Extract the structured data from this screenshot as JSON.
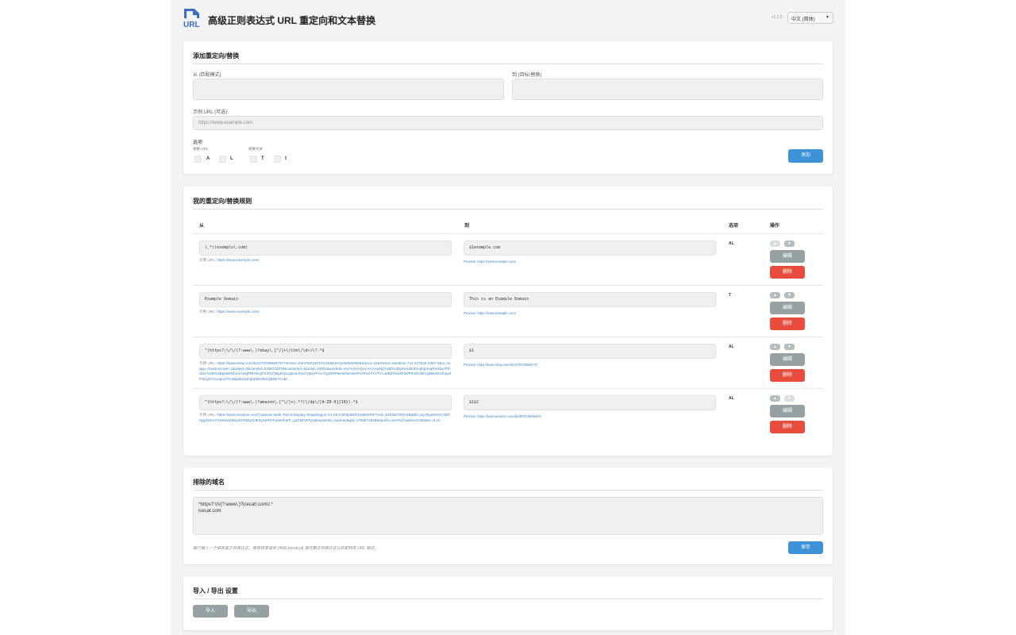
{
  "app": {
    "title": "高级正则表达式 URL 重定向和文本替换",
    "logo_text": "URL",
    "version": "v1.2.0",
    "language": "中文 (简体)"
  },
  "add_section": {
    "title": "添加重定向/替换",
    "from_label": "从 (匹配模式)",
    "to_label": "到 (目标/替换)",
    "example_label": "示例 URL (可选)",
    "example_placeholder": "https://www.example.com",
    "options_label": "选项",
    "replace_url_label": "替换 URL",
    "replace_text_label": "替换文本",
    "checkbox_a": "A",
    "checkbox_l": "L",
    "checkbox_T": "T",
    "checkbox_t": "t",
    "add_button": "添加"
  },
  "rules_section": {
    "title": "我的重定向/替换规则",
    "col_from": "从",
    "col_to": "到",
    "col_options": "选项",
    "col_actions": "操作",
    "example_prefix": "示例 URL:",
    "edit_label": "编辑",
    "delete_label": "删除",
    "up_icon": "▲",
    "down_icon": "▼",
    "rules": [
      {
        "from": "(.*)(exemplo\\.com)",
        "example": "https://www.exemplo.com/",
        "to": "$1example.com",
        "preview": "Preview: https://www.example.com/",
        "options": "AL"
      },
      {
        "from": "Example Domain",
        "example": "https://www.example.com/",
        "to": "This is an Example Domain",
        "preview": "Preview: https://www.example.com/",
        "options": "T"
      },
      {
        "from": "^(https?:\\/\\/(?:www\\.)?ebay\\.[^/]+\\/itm\\/\\d+)\\?.*$",
        "example": "https://www.ebay.com/itm/276709550737?mmsrc=01KFDZ1SFZ4V2X9HZAQA83MG9M&mkcid=16&mkevt=1&mkrid=711-127632-2357-0&ul_noapp=true&norover=1&siteid=0&campid=5338722076&customid=&toolid=10001&amdata=enc%3AAQALAAAAwNjJ%3D%3DpNAuRIIEmpbgVuaRH1bxJl7EwbC%2B%2BpbeMShX1ASejPBH9GpFInF2Y2kg5TjUpqkULFpUTg8gYFUx7cgs6RP9eSEWnWAFClRXrmYVTYL4ZBZX4wRr3DPrhOIUbbYgbBpW1nhpwfPSHyb7XuUpoAT%2BpkkOoZVjbEBO0kXQ9ZEY%3D",
        "to": "$1",
        "preview": "Preview: https://www.ebay.com/itm/276709550737",
        "options": "AL"
      },
      {
        "from": "^(https?:\\/\\/(?:www\\.)?amazon\\.[^\\/]+).*?(\\/dp\\/[A-Z0-9]{10}).*$",
        "example": "https://www.amazon.com/Coporan-Multi-Touch-Display-Snapdragon-X1-26-100/dp/B0F1M6M2HX?crid=1DENGT8V2XB&dib=eyJ2IjoiMSJ9.XBT0ygd4rKmYhe9ea2WepM1RMgGHE5ySeRN7oxWeh4rP_gcD8ZVEhQ&keywords=coporan&qid=1765671848&sprefix=ace%2Caps%2C392&sr=8-11",
        "to": "$1$2",
        "preview": "Preview: https://www.amazon.com/dp/B0F1M6M2HX",
        "options": "AL"
      }
    ]
  },
  "excluded_section": {
    "title": "排除的域名",
    "domains": [
      "^https?:\\/\\/(?:www\\.)?icecat\\.com\\/.*",
      "icecat.com"
    ],
    "hint": "每行输入一个域名或正则表达式。使用简单域名 (例如 icecat.pl) 或完整正则表达式以匹配特定 URL 模式。",
    "save_button": "保存"
  },
  "import_export_section": {
    "title": "导入 / 导出 设置",
    "import_button": "导入",
    "export_button": "导出"
  },
  "colors": {
    "primary": "#3d92d8",
    "danger": "#e74c3c",
    "secondary": "#95a1a2",
    "logo": "#3a6cc4"
  }
}
